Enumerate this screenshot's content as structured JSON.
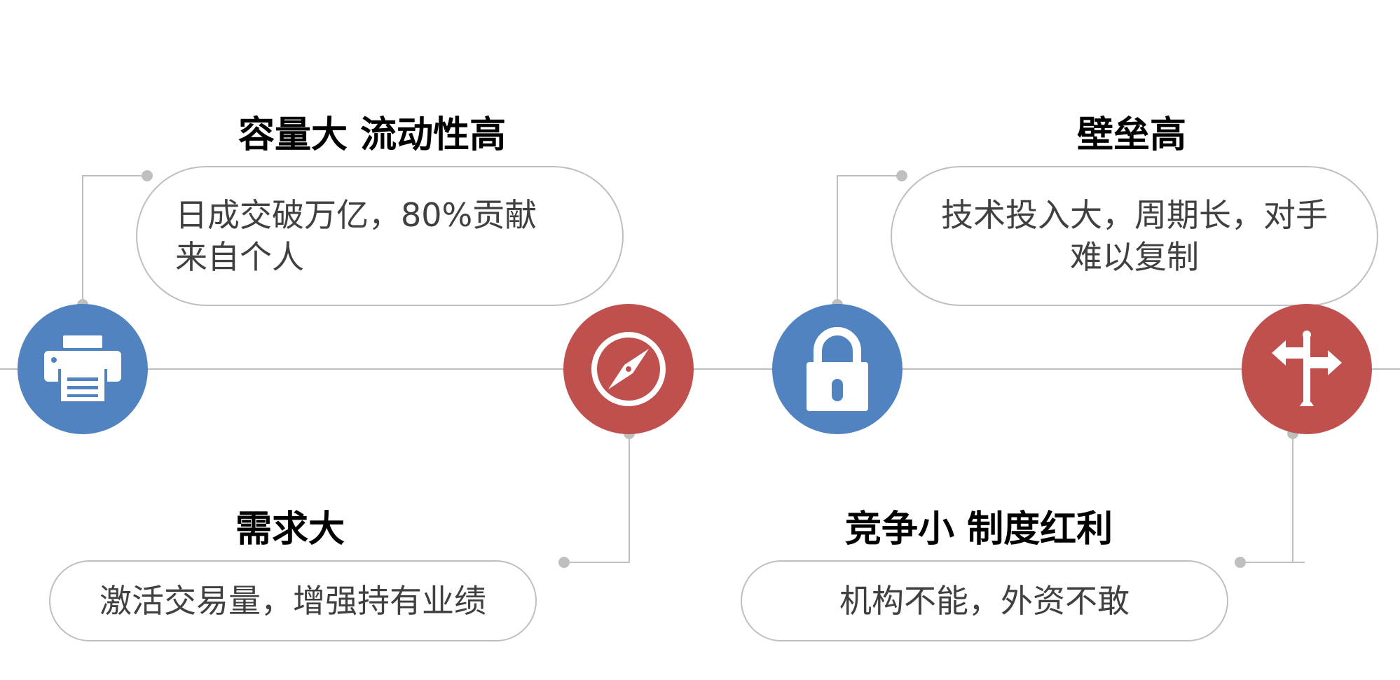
{
  "colors": {
    "blue": "#5083c0",
    "red": "#c0504d",
    "line": "#bfbfbf",
    "text": "#404040"
  },
  "items": [
    {
      "title": "容量大 流动性高",
      "text": "日成交破万亿，80%贡献来自个人",
      "icon": "printer-icon",
      "color": "blue"
    },
    {
      "title": "需求大",
      "text": "激活交易量，增强持有业绩",
      "icon": "compass-icon",
      "color": "red"
    },
    {
      "title": "壁垒高",
      "text": "技术投入大，周期长，对手难以复制",
      "icon": "lock-icon",
      "color": "blue"
    },
    {
      "title": "竞争小 制度红利",
      "text": "机构不能，外资不敢",
      "icon": "signpost-icon",
      "color": "red"
    }
  ]
}
